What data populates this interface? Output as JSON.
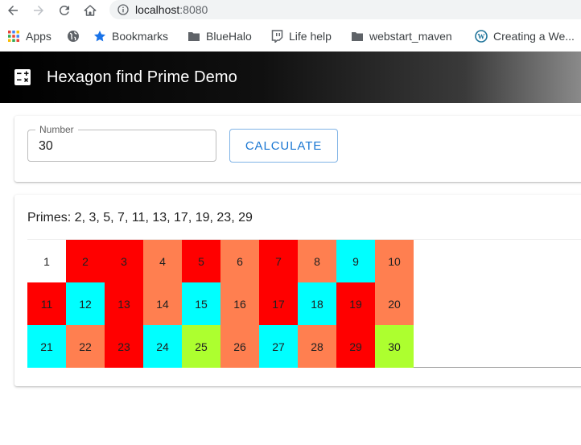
{
  "browser": {
    "url_host": "localhost",
    "url_port": ":8080",
    "bookmarks": [
      {
        "label": "Apps",
        "icon": "apps-grid-icon"
      },
      {
        "label": "",
        "icon": "globe-icon"
      },
      {
        "label": "Bookmarks",
        "icon": "star-icon"
      },
      {
        "label": "BlueHalo",
        "icon": "folder-icon"
      },
      {
        "label": "Life help",
        "icon": "twitch-icon"
      },
      {
        "label": "webstart_maven",
        "icon": "folder-icon"
      },
      {
        "label": "Creating a We...",
        "icon": "wordpress-icon"
      }
    ]
  },
  "appbar": {
    "title": "Hexagon find Prime Demo"
  },
  "form": {
    "number_label": "Number",
    "number_value": "30",
    "calculate_label": "CALCULATE"
  },
  "results": {
    "primes_text": "Primes: 2, 3, 5, 7, 11, 13, 17, 19, 23, 29"
  },
  "colors": {
    "white": "#ffffff",
    "red": "#ff0000",
    "coral": "#ff7f50",
    "cyan": "#00ffff",
    "green": "#adff2f",
    "accent": "#1976d2"
  },
  "cells": [
    {
      "n": "1",
      "color": "white"
    },
    {
      "n": "2",
      "color": "red"
    },
    {
      "n": "3",
      "color": "red"
    },
    {
      "n": "4",
      "color": "coral"
    },
    {
      "n": "5",
      "color": "red"
    },
    {
      "n": "6",
      "color": "coral"
    },
    {
      "n": "7",
      "color": "red"
    },
    {
      "n": "8",
      "color": "coral"
    },
    {
      "n": "9",
      "color": "cyan"
    },
    {
      "n": "10",
      "color": "coral"
    },
    {
      "n": "11",
      "color": "red"
    },
    {
      "n": "12",
      "color": "cyan"
    },
    {
      "n": "13",
      "color": "red"
    },
    {
      "n": "14",
      "color": "coral"
    },
    {
      "n": "15",
      "color": "cyan"
    },
    {
      "n": "16",
      "color": "coral"
    },
    {
      "n": "17",
      "color": "red"
    },
    {
      "n": "18",
      "color": "cyan"
    },
    {
      "n": "19",
      "color": "red"
    },
    {
      "n": "20",
      "color": "coral"
    },
    {
      "n": "21",
      "color": "cyan"
    },
    {
      "n": "22",
      "color": "coral"
    },
    {
      "n": "23",
      "color": "red"
    },
    {
      "n": "24",
      "color": "cyan"
    },
    {
      "n": "25",
      "color": "green"
    },
    {
      "n": "26",
      "color": "coral"
    },
    {
      "n": "27",
      "color": "cyan"
    },
    {
      "n": "28",
      "color": "coral"
    },
    {
      "n": "29",
      "color": "red"
    },
    {
      "n": "30",
      "color": "green"
    }
  ]
}
